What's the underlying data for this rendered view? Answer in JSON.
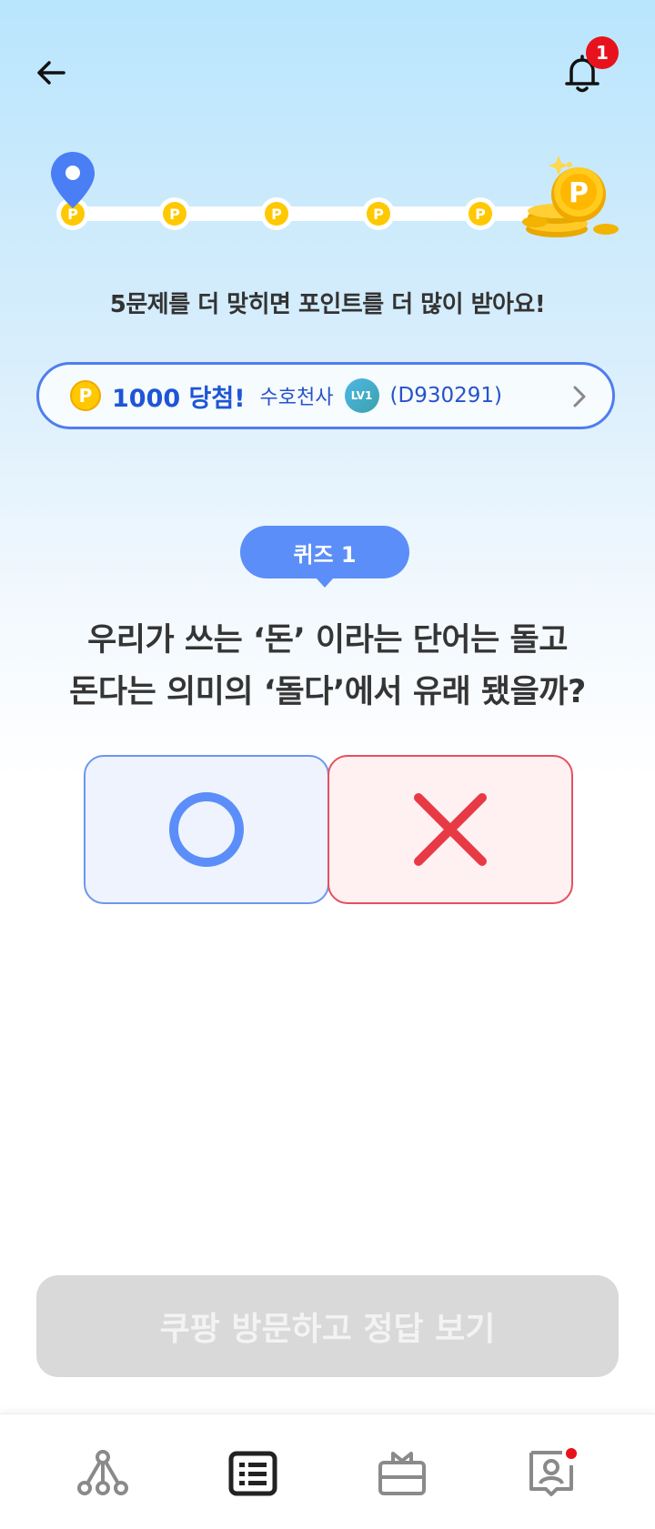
{
  "header": {
    "notification_count": "1"
  },
  "progress": {
    "steps": [
      "P",
      "P",
      "P",
      "P",
      "P"
    ],
    "current_step": 1,
    "reward_coin_label": "P",
    "hint": "5문제를 더 맞히면 포인트를 더 많이 받아요!"
  },
  "winner": {
    "coin_label": "P",
    "amount": "1000 당첨!",
    "name": "수호천사",
    "level": "LV1",
    "user_id": "(D930291)"
  },
  "quiz": {
    "tag": "퀴즈 1",
    "question_line1": "우리가 쓰는 ‘돈’ 이라는 단어는 돌고",
    "question_line2": "돈다는 의미의 ‘돌다’에서 유래 됐을까?"
  },
  "answers": {
    "o_color": "#5b8ef8",
    "x_color": "#e83a45"
  },
  "cta": {
    "label": "쿠팡 방문하고 정답 보기"
  },
  "tabbar": {
    "items": [
      "network-icon",
      "list-icon",
      "gift-icon",
      "profile-icon"
    ],
    "active_index": 1,
    "profile_has_dot": true
  },
  "colors": {
    "accent": "#5b8ef8",
    "coin": "#ffc800",
    "badge_red": "#e8121d"
  }
}
